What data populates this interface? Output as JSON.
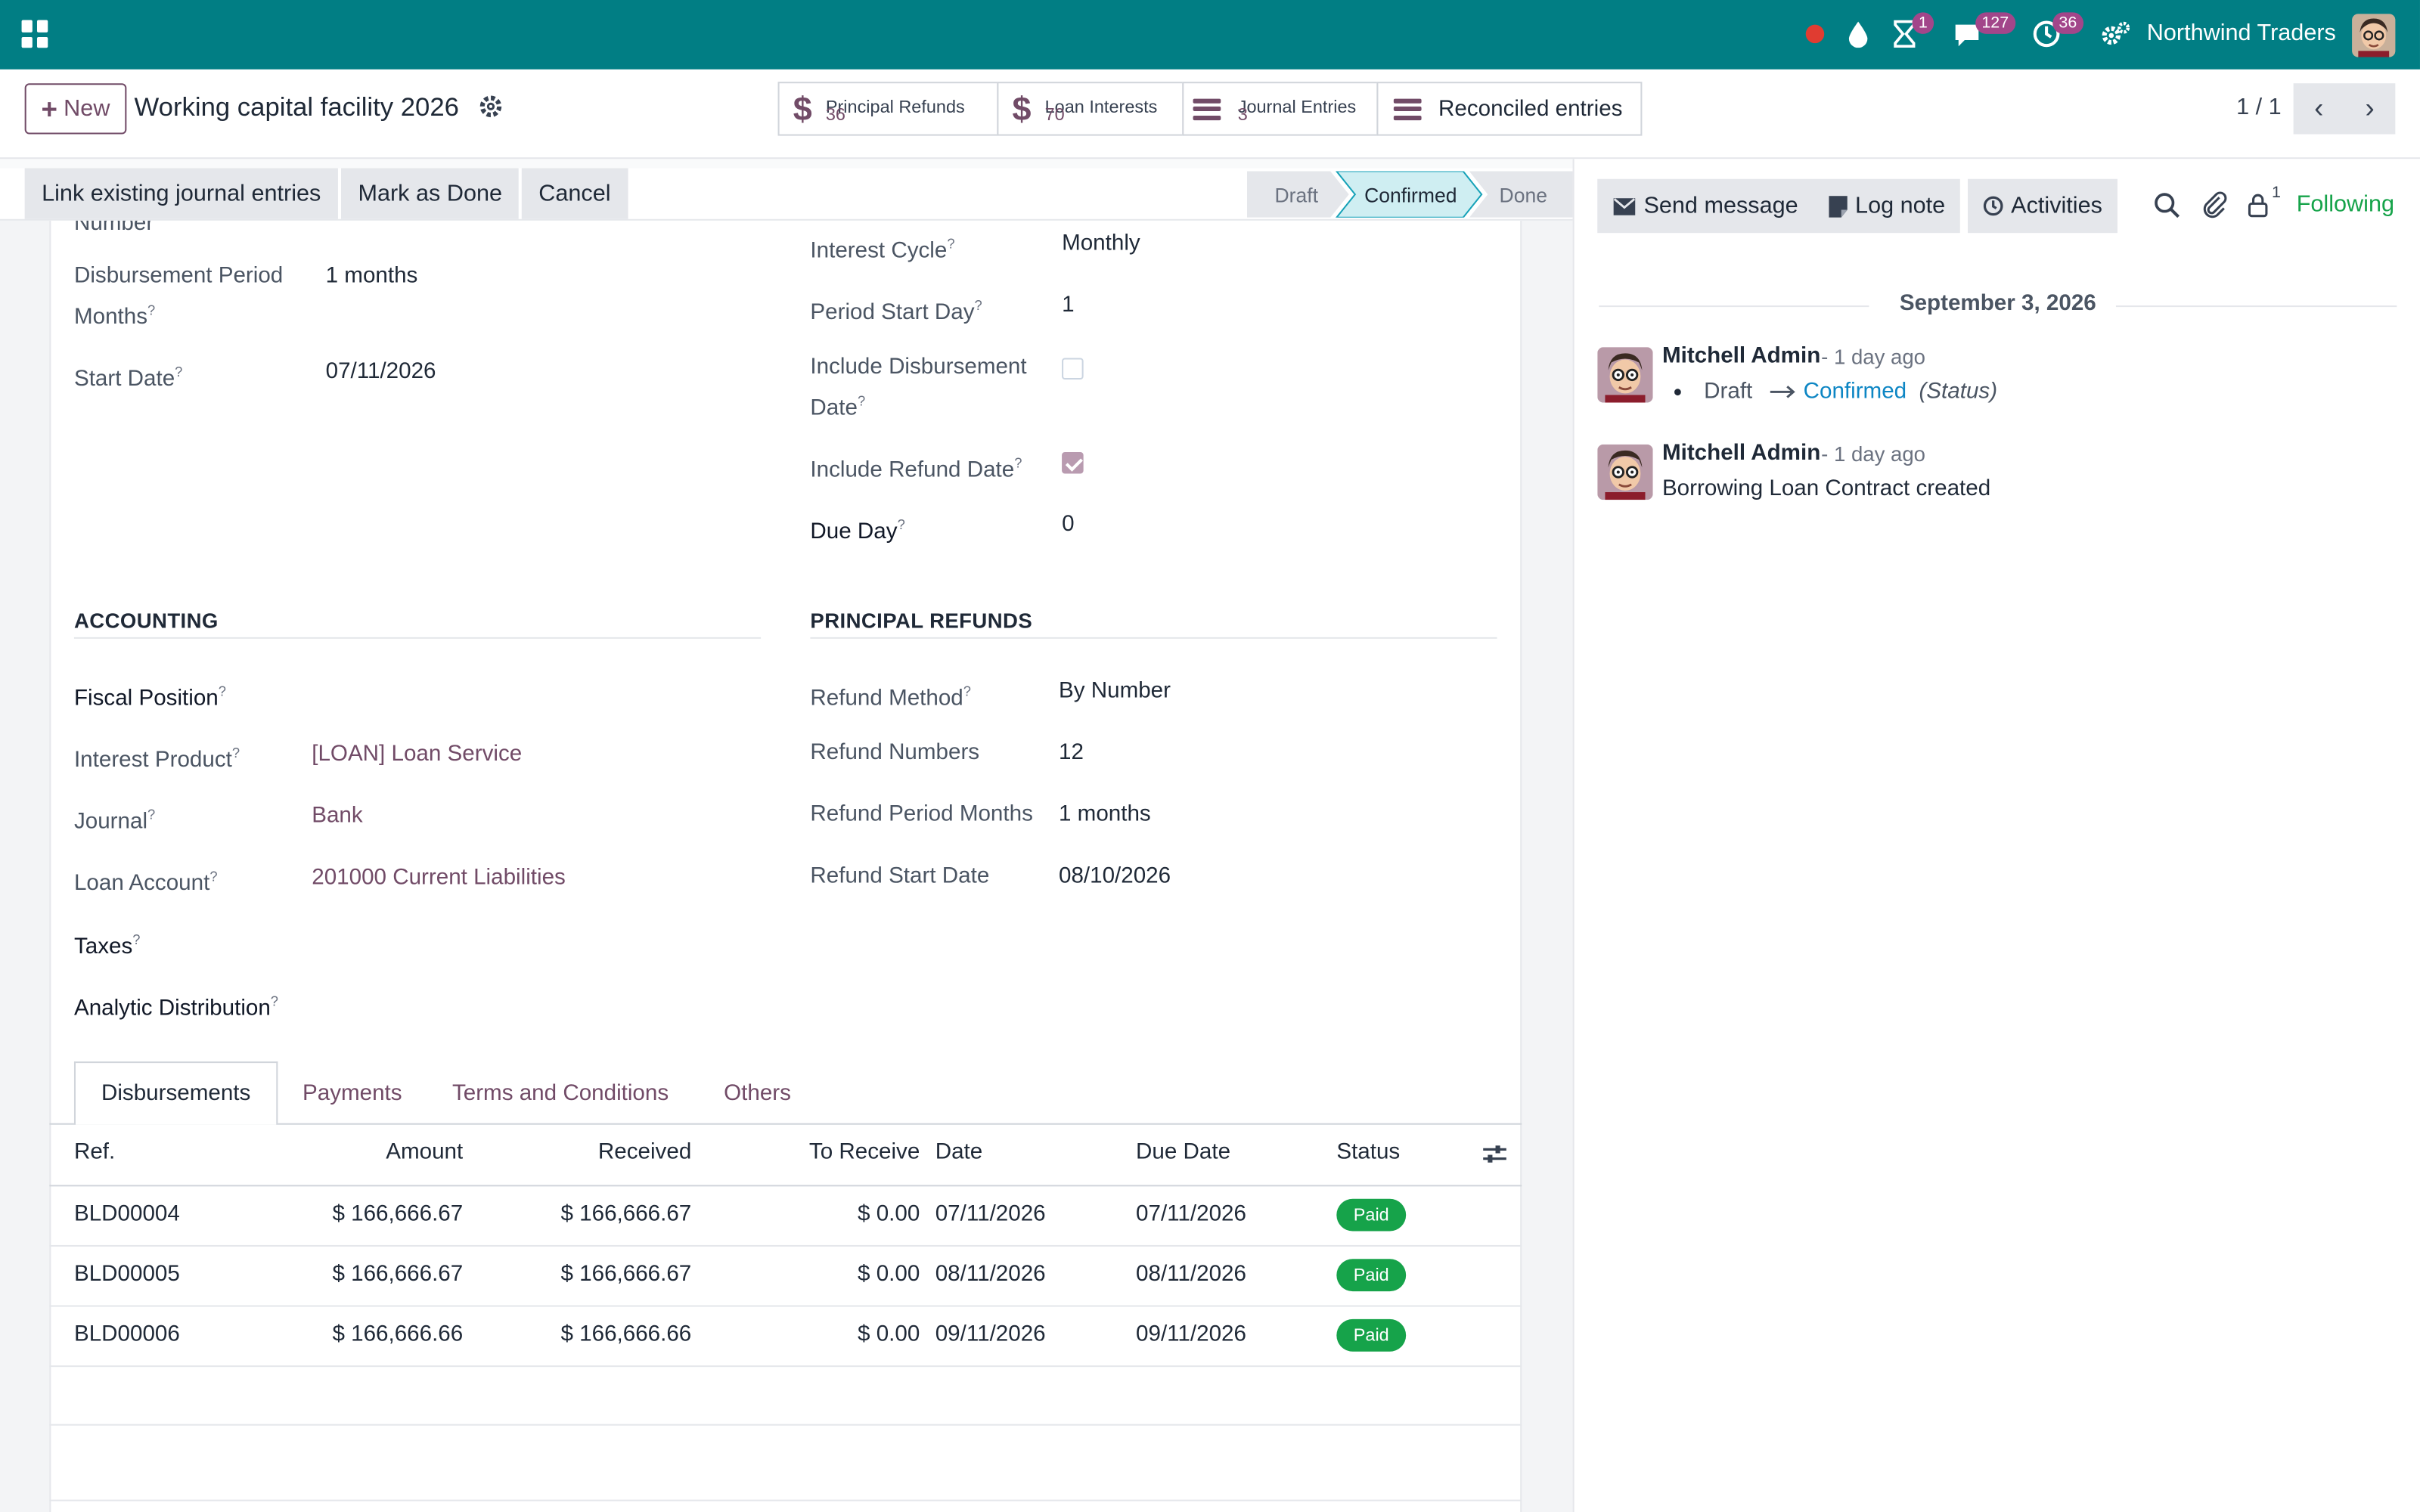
{
  "navbar": {
    "company": "Northwind Traders",
    "badges": {
      "activity": "1",
      "messages": "127",
      "clock": "36"
    },
    "colors": {
      "bar": "#017e84",
      "badge": "#a2468a"
    }
  },
  "control_panel": {
    "new_label": "New",
    "record_title": "Working capital facility 2026",
    "smart_buttons": [
      {
        "label": "Principal Refunds",
        "value": "36",
        "icon": "dollar-icon"
      },
      {
        "label": "Loan Interests",
        "value": "70",
        "icon": "dollar-icon"
      },
      {
        "label": "Journal Entries",
        "value": "3",
        "icon": "list-icon"
      },
      {
        "label": "Reconciled entries",
        "icon": "list-icon"
      }
    ],
    "pager": "1 / 1"
  },
  "statusbar": {
    "buttons": [
      "Link existing journal entries",
      "Mark as Done",
      "Cancel"
    ],
    "stages": [
      "Draft",
      "Confirmed",
      "Done"
    ],
    "active_stage": "Confirmed"
  },
  "form": {
    "left": {
      "cut_label": "Number",
      "disb_period_label": "Disbursement Period Months",
      "disb_period_value": "1 months",
      "start_date_label": "Start Date",
      "start_date_value": "07/11/2026"
    },
    "right": {
      "interest_cycle_label": "Interest Cycle",
      "interest_cycle_value": "Monthly",
      "period_start_label": "Period Start Day",
      "period_start_value": "1",
      "incl_disb_label": "Include Disbursement Date",
      "incl_disb_checked": false,
      "incl_refund_label": "Include Refund Date",
      "incl_refund_checked": true,
      "due_day_label": "Due Day",
      "due_day_value": "0"
    },
    "accounting": {
      "title": "ACCOUNTING",
      "fiscal_position_label": "Fiscal Position",
      "interest_product_label": "Interest Product",
      "interest_product_value": "[LOAN] Loan Service",
      "journal_label": "Journal",
      "journal_value": "Bank",
      "loan_account_label": "Loan Account",
      "loan_account_value": "201000 Current Liabilities",
      "taxes_label": "Taxes",
      "analytic_label": "Analytic Distribution"
    },
    "principal_refunds": {
      "title": "PRINCIPAL REFUNDS",
      "method_label": "Refund Method",
      "method_value": "By Number",
      "numbers_label": "Refund Numbers",
      "numbers_value": "12",
      "period_label": "Refund Period Months",
      "period_value": "1 months",
      "start_label": "Refund Start Date",
      "start_value": "08/10/2026"
    }
  },
  "tabs": [
    "Disbursements",
    "Payments",
    "Terms and Conditions",
    "Others"
  ],
  "table": {
    "headers": [
      "Ref.",
      "Amount",
      "Received",
      "To Receive",
      "Date",
      "Due Date",
      "Status"
    ],
    "rows": [
      {
        "ref": "BLD00004",
        "amount": "$ 166,666.67",
        "received": "$ 166,666.67",
        "to_receive": "$ 0.00",
        "date": "07/11/2026",
        "due": "07/11/2026",
        "status": "Paid"
      },
      {
        "ref": "BLD00005",
        "amount": "$ 166,666.67",
        "received": "$ 166,666.67",
        "to_receive": "$ 0.00",
        "date": "08/11/2026",
        "due": "08/11/2026",
        "status": "Paid"
      },
      {
        "ref": "BLD00006",
        "amount": "$ 166,666.66",
        "received": "$ 166,666.66",
        "to_receive": "$ 0.00",
        "date": "09/11/2026",
        "due": "09/11/2026",
        "status": "Paid"
      }
    ]
  },
  "chatter": {
    "send_message": "Send message",
    "log_note": "Log note",
    "activities": "Activities",
    "followers_count": "1",
    "following": "Following",
    "date": "September 3, 2026",
    "messages": [
      {
        "author": "Mitchell Admin",
        "ago": "- 1 day ago",
        "from": "Draft",
        "to": "Confirmed",
        "field": "(Status)"
      },
      {
        "author": "Mitchell Admin",
        "ago": "- 1 day ago",
        "body": "Borrowing Loan Contract created"
      }
    ]
  }
}
